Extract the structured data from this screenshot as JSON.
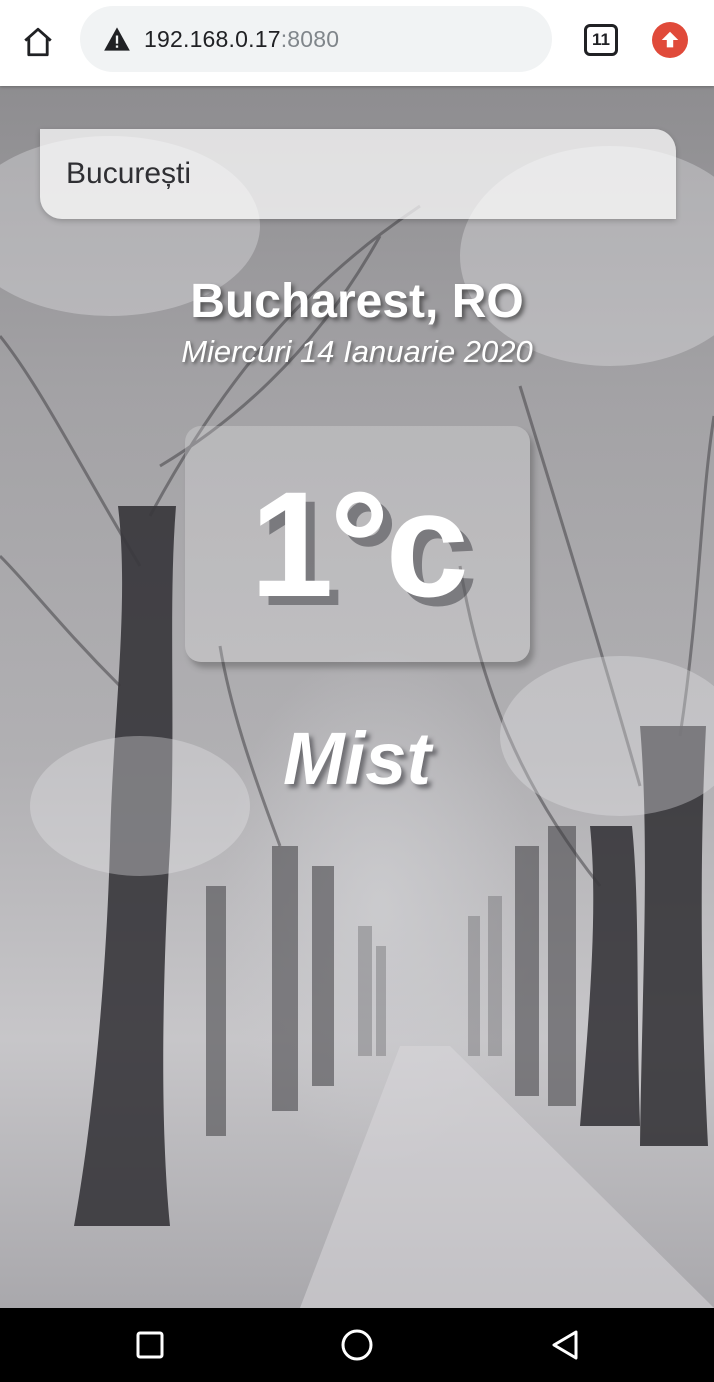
{
  "browser": {
    "url_host": "192.168.0.17",
    "url_port": ":8080",
    "tab_count": "11",
    "icons": {
      "home": "home-icon",
      "security": "warning-icon",
      "tabs": "tab-switcher-icon",
      "update": "update-arrow-icon"
    }
  },
  "weather": {
    "search_value": "București",
    "location": "Bucharest, RO",
    "date": "Miercuri 14 Ianuarie 2020",
    "temperature": "1°c",
    "condition": "Mist"
  },
  "android_nav": {
    "icons": [
      "recents-icon",
      "home-circle-icon",
      "back-icon"
    ]
  },
  "colors": {
    "update_badge": "#e04a3a",
    "url_bar": "#f1f3f4"
  }
}
